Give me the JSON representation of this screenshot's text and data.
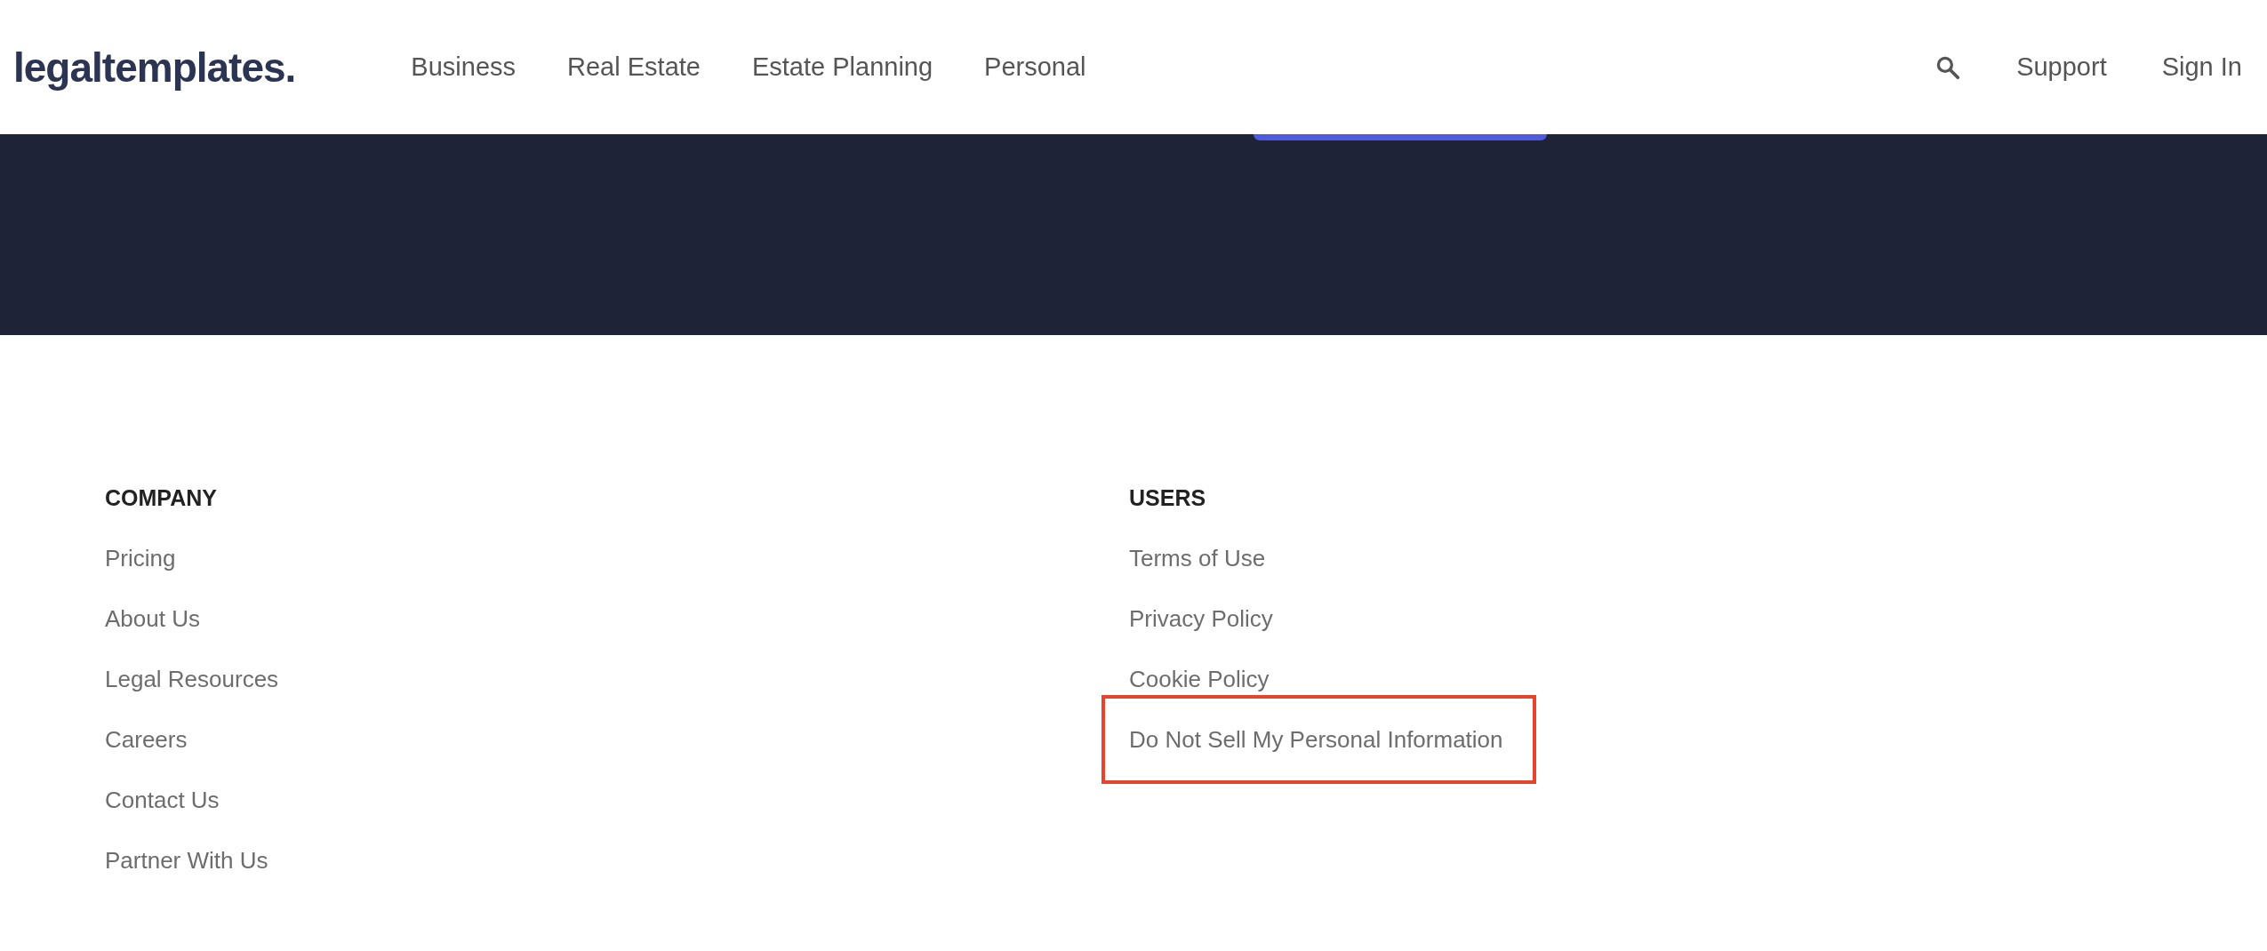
{
  "header": {
    "logo": "legaltemplates.",
    "nav": [
      "Business",
      "Real Estate",
      "Estate Planning",
      "Personal"
    ],
    "right_links": [
      "Support",
      "Sign In"
    ]
  },
  "footer": {
    "columns": [
      {
        "heading": "COMPANY",
        "links": [
          {
            "label": "Pricing",
            "highlighted": false
          },
          {
            "label": "About Us",
            "highlighted": false
          },
          {
            "label": "Legal Resources",
            "highlighted": false
          },
          {
            "label": "Careers",
            "highlighted": false
          },
          {
            "label": "Contact Us",
            "highlighted": false
          },
          {
            "label": "Partner With Us",
            "highlighted": false
          }
        ]
      },
      {
        "heading": "USERS",
        "links": [
          {
            "label": "Terms of Use",
            "highlighted": false
          },
          {
            "label": "Privacy Policy",
            "highlighted": false
          },
          {
            "label": "Cookie Policy",
            "highlighted": false
          },
          {
            "label": "Do Not Sell My Personal Information",
            "highlighted": true
          }
        ]
      }
    ]
  }
}
